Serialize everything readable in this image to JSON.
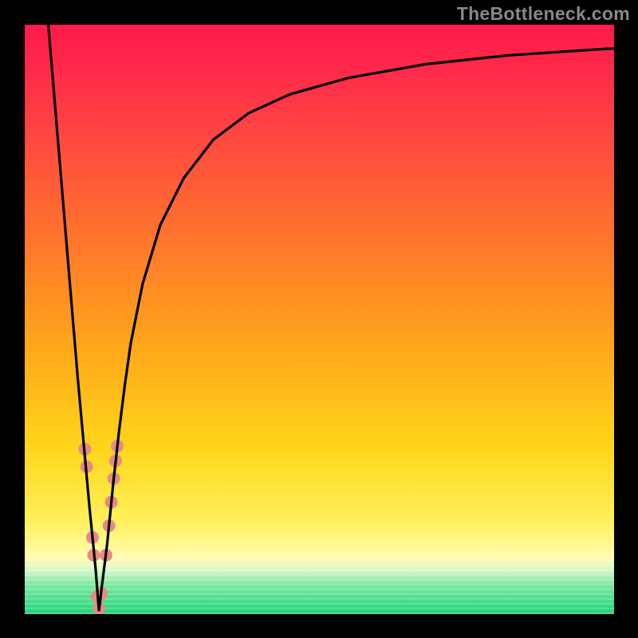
{
  "watermark": "TheBottleneck.com",
  "colors": {
    "black": "#000000",
    "curve": "#000000",
    "marker": "#e58a88",
    "grad_top": "#ff1a4b",
    "grad_bottom": "#20d37c"
  },
  "chart_data": {
    "type": "line",
    "title": "",
    "xlabel": "",
    "ylabel": "",
    "xlim": [
      0,
      100
    ],
    "ylim": [
      0,
      100
    ],
    "grid": false,
    "series": [
      {
        "name": "bottleneck-curve",
        "stroke": "#000000",
        "x": [
          4,
          5,
          6,
          7,
          8,
          9,
          10,
          11,
          12,
          12.6,
          13,
          14,
          15,
          16,
          17,
          18,
          20,
          23,
          27,
          32,
          38,
          45,
          55,
          68,
          82,
          100
        ],
        "y": [
          100,
          88,
          76,
          64,
          52,
          40,
          29,
          18,
          8,
          0.5,
          4,
          12,
          22,
          31,
          39,
          46,
          56,
          66,
          74,
          80.5,
          85,
          88.2,
          91,
          93.3,
          94.8,
          96
        ]
      }
    ],
    "annotations": {
      "marker_points": [
        {
          "x": 10.2,
          "y": 28
        },
        {
          "x": 10.5,
          "y": 25
        },
        {
          "x": 11.5,
          "y": 13
        },
        {
          "x": 11.7,
          "y": 10
        },
        {
          "x": 12.3,
          "y": 3
        },
        {
          "x": 12.6,
          "y": 1
        },
        {
          "x": 13.0,
          "y": 3.5
        },
        {
          "x": 13.8,
          "y": 10
        },
        {
          "x": 14.3,
          "y": 15
        },
        {
          "x": 14.7,
          "y": 19
        },
        {
          "x": 15.1,
          "y": 23
        },
        {
          "x": 15.4,
          "y": 26
        },
        {
          "x": 15.7,
          "y": 28.5
        }
      ],
      "marker_color": "#e58a88",
      "marker_radius_px": 8
    }
  }
}
